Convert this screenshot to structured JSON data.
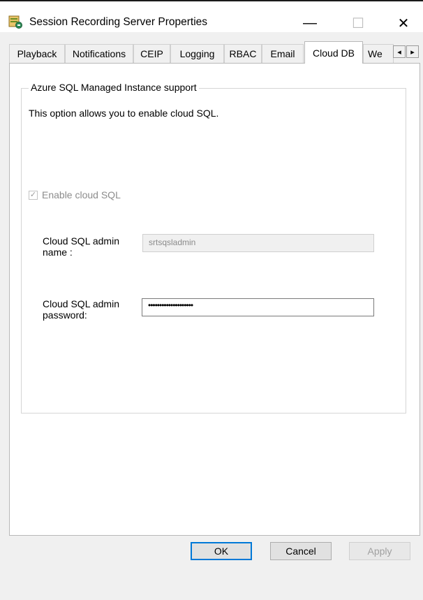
{
  "window": {
    "title": "Session Recording Server Properties",
    "minimize_glyph": "—",
    "maximize_glyph": "☐",
    "close_glyph": "✕"
  },
  "tabs": [
    {
      "label": "Playback"
    },
    {
      "label": "Notifications"
    },
    {
      "label": "CEIP"
    },
    {
      "label": "Logging"
    },
    {
      "label": "RBAC"
    },
    {
      "label": "Email"
    },
    {
      "label": "Cloud DB",
      "active": true
    },
    {
      "label": "We"
    }
  ],
  "tab_scroll": {
    "left_glyph": "◂",
    "right_glyph": "▸"
  },
  "group": {
    "legend": "Azure SQL Managed Instance support",
    "description": "This option allows you to enable cloud SQL."
  },
  "enable_checkbox": {
    "label": "Enable cloud SQL",
    "checked": true,
    "disabled": true,
    "check_glyph": "✓"
  },
  "admin_name": {
    "label_line1": "Cloud SQL admin",
    "label_line2": "name :",
    "value": "srtsqsladmin"
  },
  "admin_password": {
    "label_line1": "Cloud SQL admin",
    "label_line2": "password:",
    "value": "••••••••••••••••••••"
  },
  "buttons": {
    "ok": "OK",
    "cancel": "Cancel",
    "apply": "Apply"
  },
  "colors": {
    "accent": "#0078d7",
    "panel": "#ffffff",
    "background": "#f0f0f0"
  }
}
